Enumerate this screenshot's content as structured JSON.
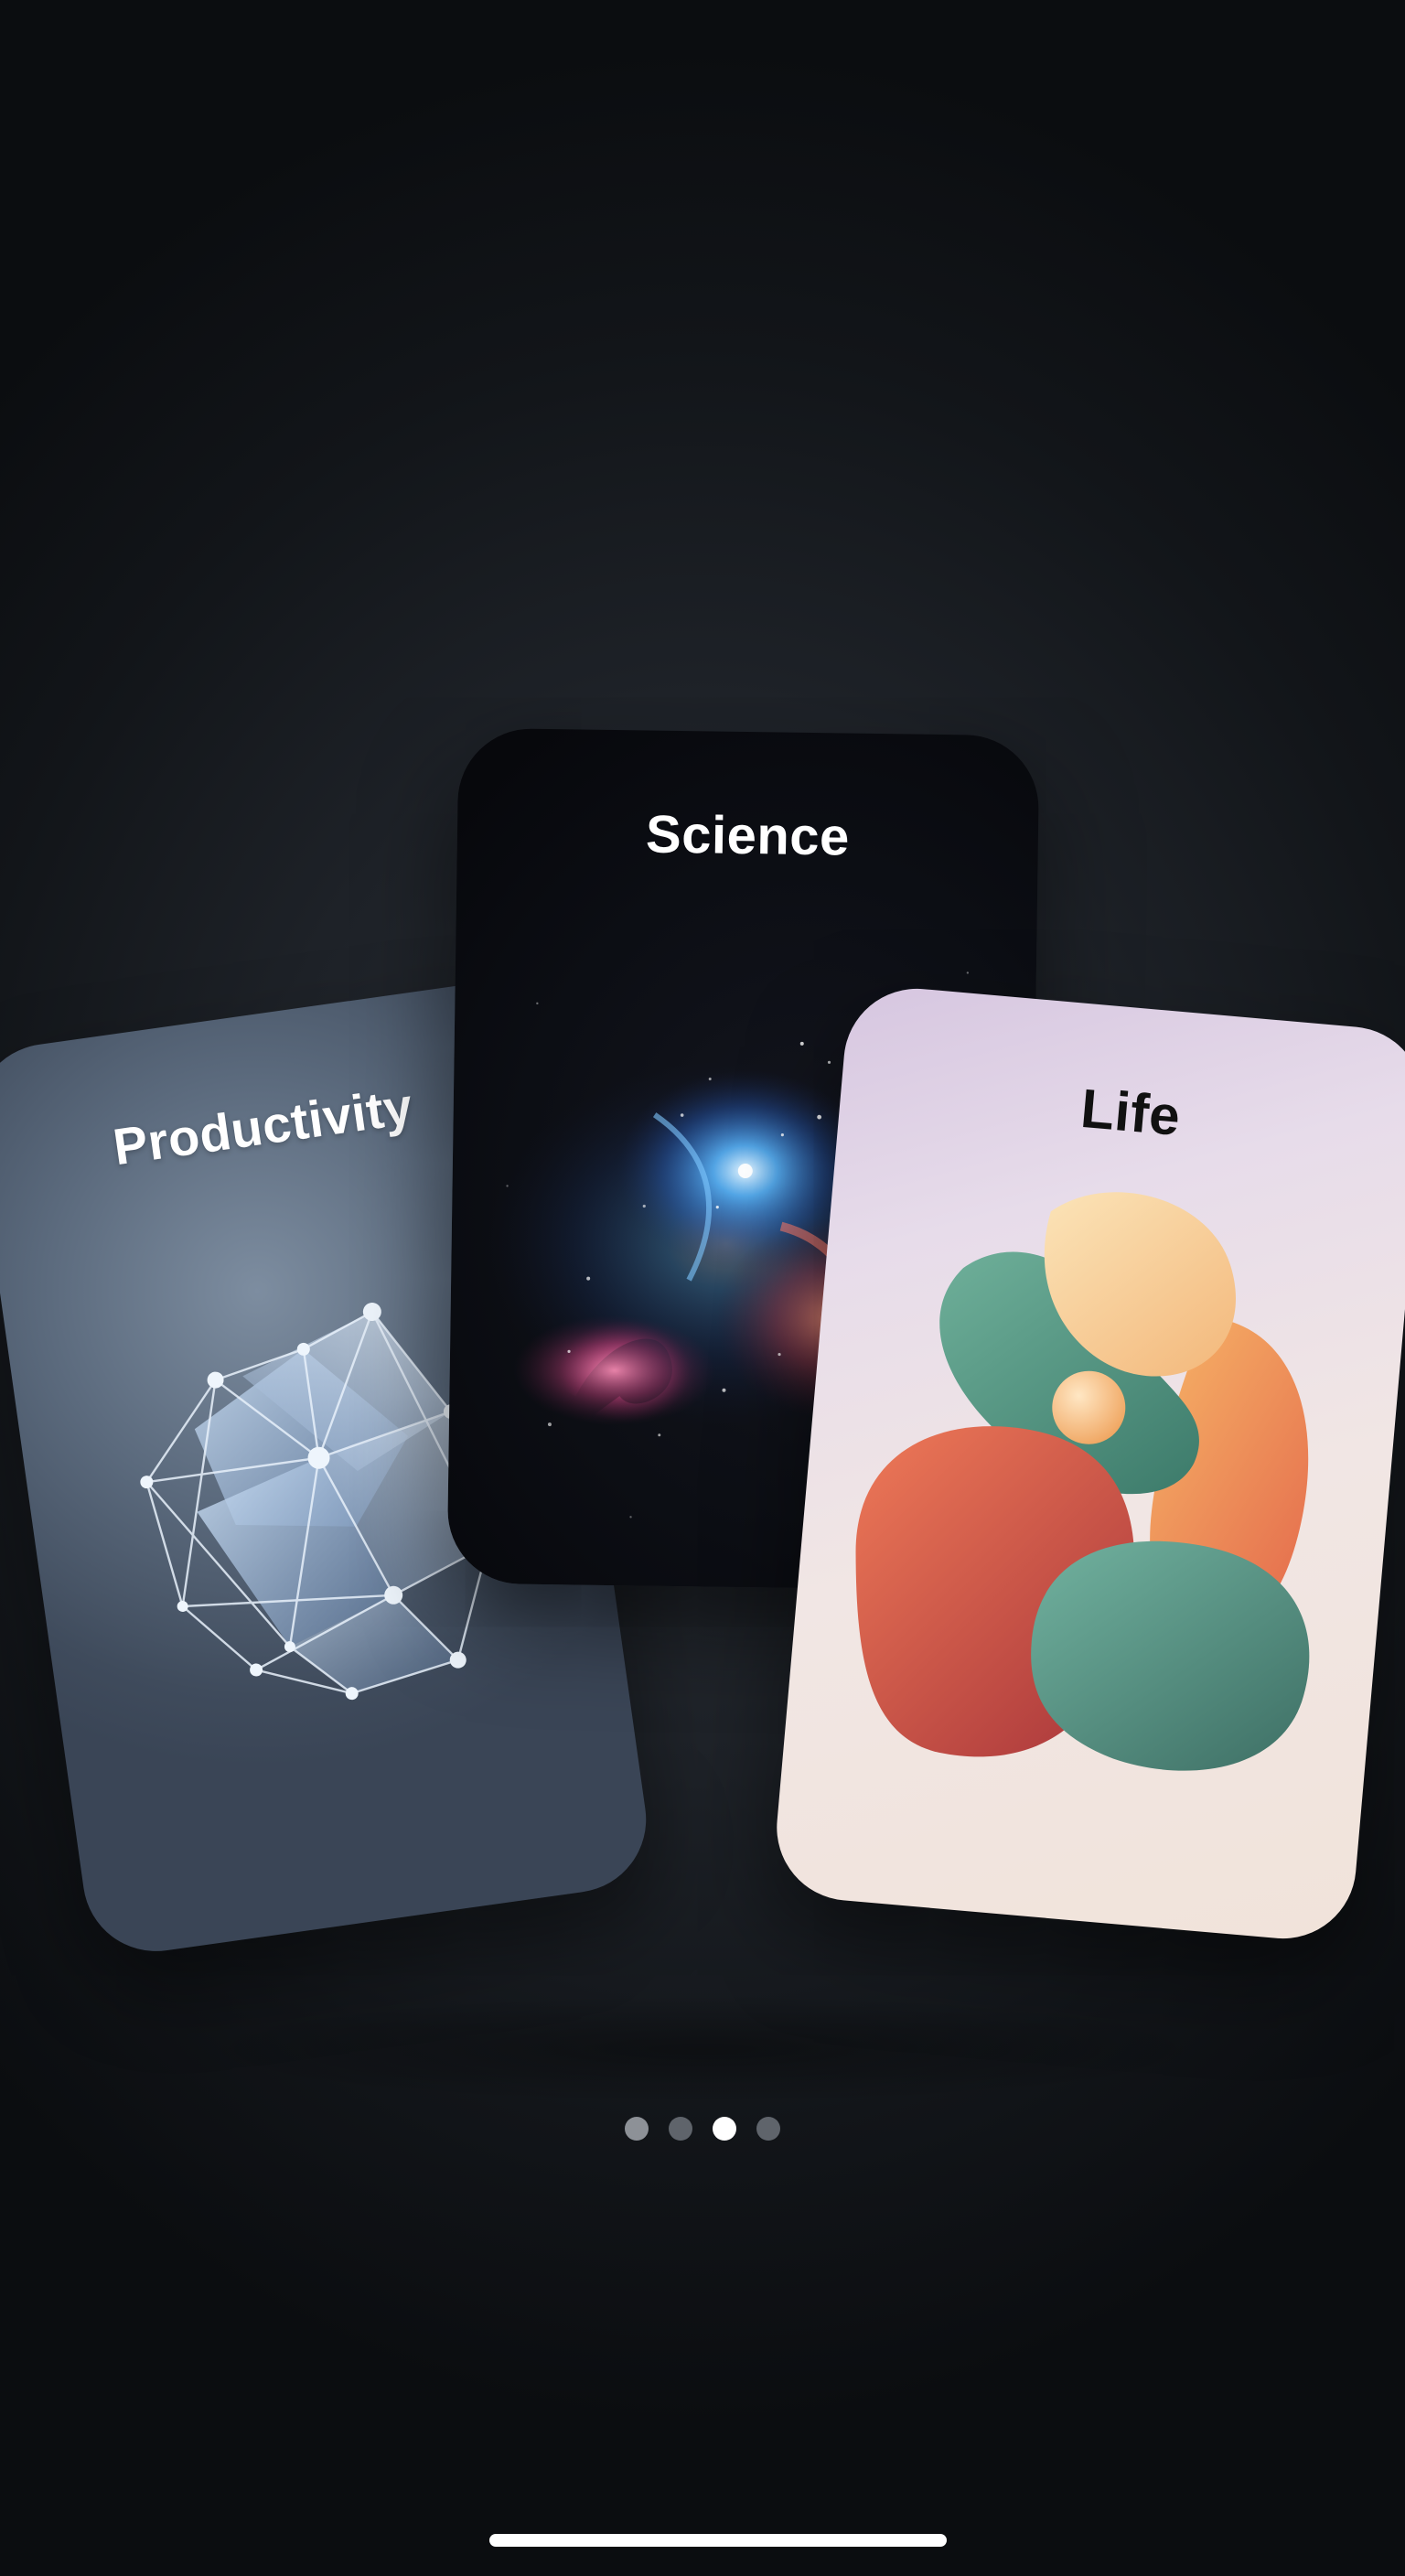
{
  "carousel": {
    "cards": [
      {
        "title": "Productivity"
      },
      {
        "title": "Science"
      },
      {
        "title": "Life"
      }
    ],
    "pagination": {
      "total": 4,
      "active_index": 2
    }
  },
  "colors": {
    "background": "#1e2228",
    "dot_inactive": "#8d9197",
    "dot_active": "#ffffff",
    "home_indicator": "#ffffff"
  }
}
